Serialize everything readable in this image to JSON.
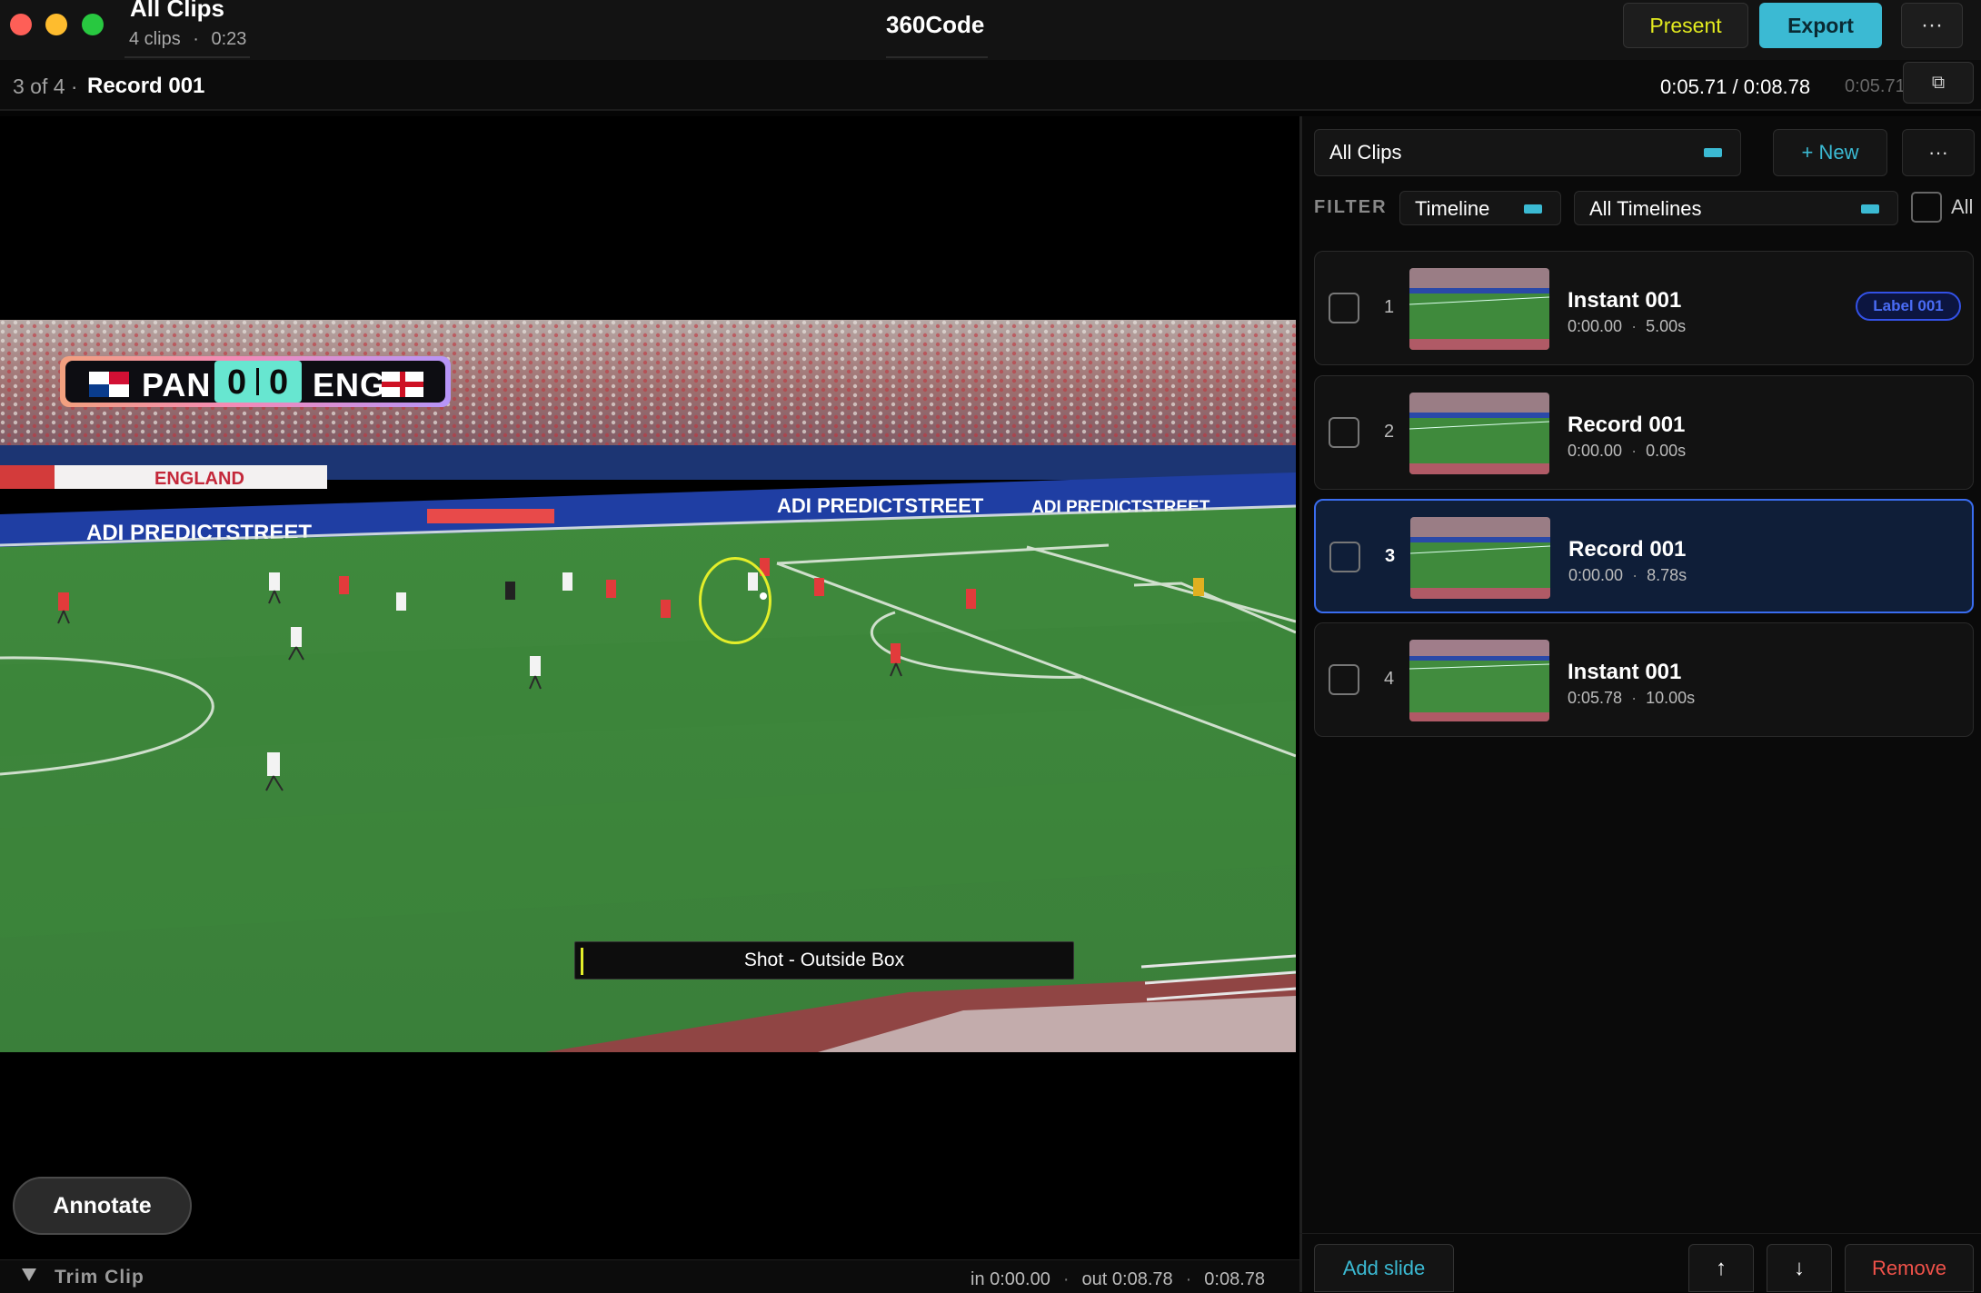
{
  "window": {
    "title": "All Clips",
    "clip_count": "4 clips",
    "sep": "·",
    "duration": "0:23"
  },
  "app": {
    "name": "360Code"
  },
  "toolbar": {
    "present_label": "Present",
    "export_label": "Export",
    "more_label": "···"
  },
  "position_bar": {
    "index_text": "3 of 4 ·",
    "clip_name": "Record 001",
    "timecode": "0:05.71 / 0:08.78",
    "timecode_secondary": "0:05.71",
    "copy_icon": "⧉"
  },
  "video": {
    "caption": "Shot - Outside Box",
    "scorebug": {
      "home": "PAN",
      "home_score": "0",
      "away_score": "0",
      "away": "ENG"
    },
    "ads": [
      "ENGLAND",
      "ADI PREDICTSTREET",
      "ADI PREDICTSTREET",
      "ADI PREDICTSTREET"
    ]
  },
  "annotate_label": "Annotate",
  "trim": {
    "label": "Trim Clip",
    "in": "in 0:00.00",
    "out": "out 0:08.78",
    "length": "0:08.78",
    "sep": "·"
  },
  "panel": {
    "clip_list_select": "All Clips",
    "new_label": "+ New",
    "more_label": "···",
    "filter_label": "FILTER",
    "timeline_select": "Timeline",
    "all_timelines_select": "All Timelines",
    "all_label": "All",
    "clips": [
      {
        "num": "1",
        "name": "Instant 001",
        "start": "0:00.00",
        "length": "5.00s",
        "label": "Label 001"
      },
      {
        "num": "2",
        "name": "Record 001",
        "start": "0:00.00",
        "length": "0.00s"
      },
      {
        "num": "3",
        "name": "Record 001",
        "start": "0:00.00",
        "length": "8.78s"
      },
      {
        "num": "4",
        "name": "Instant 001",
        "start": "0:05.78",
        "length": "10.00s"
      }
    ],
    "add_slide_label": "Add slide",
    "up_label": "↑",
    "down_label": "↓",
    "remove_label": "Remove"
  },
  "colors": {
    "accent": "#3bbad3",
    "present": "#e2ea1f",
    "selected_border": "#3a6df0",
    "remove": "#f0524a",
    "annotation": "#e3ee2a"
  }
}
